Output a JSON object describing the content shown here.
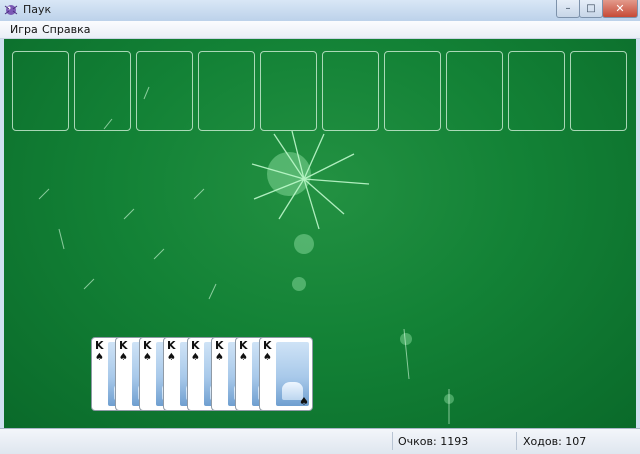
{
  "window": {
    "title": "Паук"
  },
  "menu": {
    "items": [
      "Игра",
      "Справка"
    ]
  },
  "titlebar_buttons": {
    "minimize": "–",
    "maximize": "□",
    "close": "✕"
  },
  "tableau": {
    "empty_slots": 10
  },
  "completed_cards": [
    {
      "rank": "K",
      "suit": "♠"
    },
    {
      "rank": "K",
      "suit": "♠"
    },
    {
      "rank": "K",
      "suit": "♠"
    },
    {
      "rank": "K",
      "suit": "♠"
    },
    {
      "rank": "K",
      "suit": "♠"
    },
    {
      "rank": "K",
      "suit": "♠"
    },
    {
      "rank": "K",
      "suit": "♠"
    },
    {
      "rank": "K",
      "suit": "♠"
    }
  ],
  "status": {
    "score": "Очков: 1193",
    "moves": "Ходов:  107"
  },
  "colors": {
    "felt": "#138236",
    "accent": "#c64a36"
  }
}
